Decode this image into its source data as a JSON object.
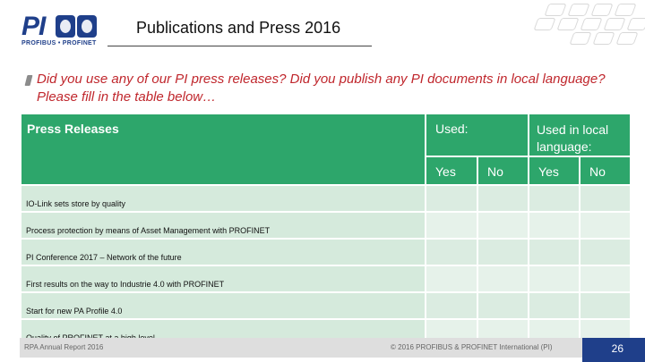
{
  "header": {
    "logo_text": "PI",
    "logo_subtext": "PROFIBUS • PROFINET",
    "title": "Publications and Press 2016"
  },
  "question": "Did you use any of our PI press releases? Did you publish any PI documents in local language? Please fill in the table below…",
  "table": {
    "col_main": "Press Releases",
    "col_used": "Used:",
    "col_used_local": "Used in local language:",
    "sub_yes": "Yes",
    "sub_no": "No",
    "sub_yes_local": "Yes",
    "sub_no_local": "No",
    "rows": [
      "IO-Link sets store by quality",
      "Process protection by means of Asset Management with PROFINET",
      "PI Conference 2017 – Network of the future",
      "First results on the way to Industrie 4.0 with PROFINET",
      "Start for new PA Profile 4.0",
      "Quality of PROFINET at a high level"
    ]
  },
  "footer": {
    "left": "RPA Annual Report 2016",
    "center": "© 2016 PROFIBUS & PROFINET International (PI)",
    "page": "26"
  },
  "colors": {
    "header_green": "#2da66b",
    "question_red": "#c0272d",
    "brand_blue": "#1f3f8a"
  }
}
